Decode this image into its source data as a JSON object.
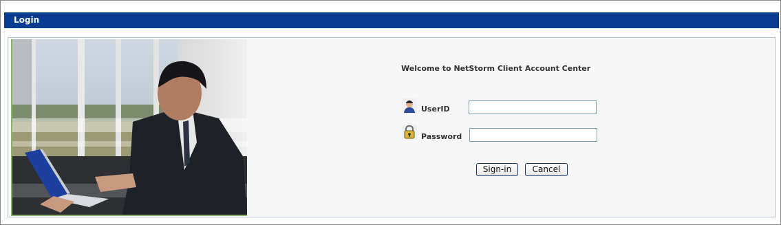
{
  "window": {
    "title": "Login"
  },
  "main": {
    "welcome_text": "Welcome to NetStorm Client Account Center",
    "userid": {
      "label": "UserID",
      "value": "",
      "icon": "user-icon"
    },
    "password": {
      "label": "Password",
      "value": "",
      "icon": "lock-icon"
    },
    "buttons": {
      "signin_label": "Sign-in",
      "cancel_label": "Cancel"
    }
  },
  "colors": {
    "title_bar": "#0a3d91",
    "panel_background": "#f7f7f7",
    "photo_border": "#8cb06a"
  }
}
